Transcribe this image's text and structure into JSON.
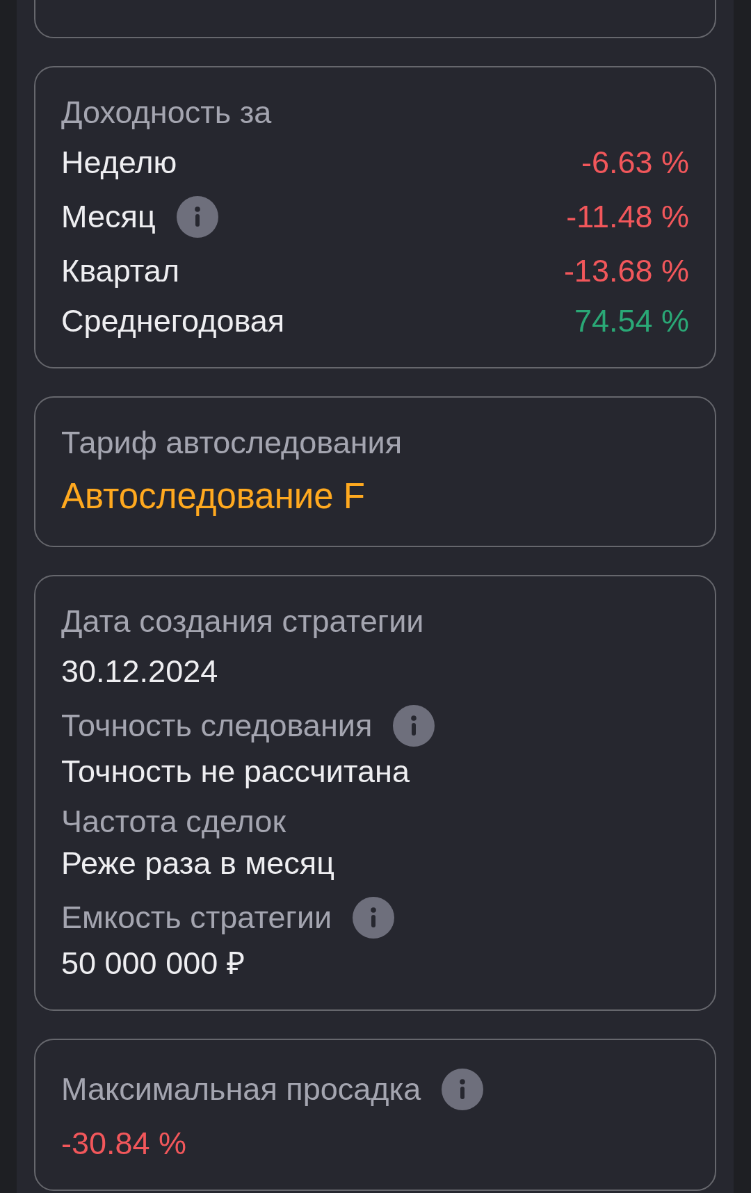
{
  "sections": [
    {
      "kind": "clipped"
    },
    {
      "kind": "returns",
      "title": "Доходность за",
      "rows": [
        {
          "label": "Неделю",
          "info": false,
          "value": "-6.63 %",
          "kind": "negative"
        },
        {
          "label": "Месяц",
          "info": true,
          "value": "-11.48 %",
          "kind": "negative"
        },
        {
          "label": "Квартал",
          "info": false,
          "value": "-13.68 %",
          "kind": "negative"
        },
        {
          "label": "Среднегодовая",
          "info": false,
          "value": "74.54 %",
          "kind": "positive"
        }
      ]
    },
    {
      "kind": "fields",
      "fields": [
        {
          "label": "Тариф автоследования",
          "info": false,
          "value": "Автоследование F",
          "kind": "accent"
        }
      ]
    },
    {
      "kind": "fields",
      "fields": [
        {
          "label": "Дата создания стратегии",
          "info": false,
          "value": "30.12.2024",
          "kind": "plain"
        },
        {
          "label": "Точность следования",
          "info": true,
          "value": "Точность не рассчитана",
          "kind": "plain"
        },
        {
          "label": "Частота сделок",
          "info": false,
          "value": "Реже раза в месяц",
          "kind": "plain"
        },
        {
          "label": "Емкость стратегии",
          "info": true,
          "value": "50 000 000 ₽",
          "kind": "plain"
        }
      ]
    },
    {
      "kind": "fields",
      "fields": [
        {
          "label": "Максимальная просадка",
          "info": true,
          "value": "-30.84 %",
          "kind": "negative"
        }
      ]
    }
  ]
}
